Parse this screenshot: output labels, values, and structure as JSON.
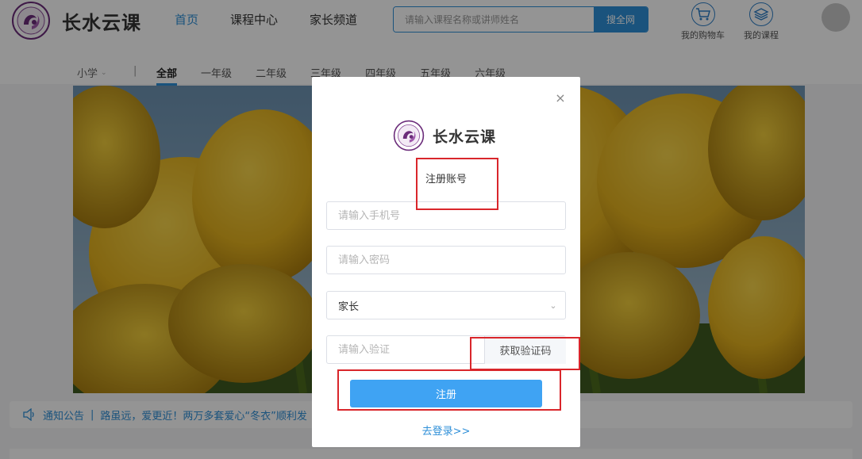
{
  "brand": {
    "name": "长水云课"
  },
  "nav": {
    "items": [
      "首页",
      "课程中心",
      "家长频道"
    ],
    "active_index": 0
  },
  "search": {
    "placeholder": "请输入课程名称或讲师姓名",
    "button": "搜全网"
  },
  "header_links": [
    {
      "label": "我的购物车",
      "icon": "shopping-cart-icon"
    },
    {
      "label": "我的课程",
      "icon": "layers-icon"
    }
  ],
  "grade_bar": {
    "level": "小学",
    "separator": "|",
    "grades": [
      "全部",
      "一年级",
      "二年级",
      "三年级",
      "四年级",
      "五年级",
      "六年级"
    ],
    "active_index": 0
  },
  "notice": {
    "label": "通知公告",
    "separator": "|",
    "text": "路虽远，爱更近！两万多套爱心“冬衣”顺利发"
  },
  "modal": {
    "close_symbol": "×",
    "brand": "长水云课",
    "title": "注册账号",
    "phone_placeholder": "请输入手机号",
    "password_placeholder": "请输入密码",
    "role_value": "家长",
    "code_placeholder": "请输入验证",
    "get_code_button": "获取验证码",
    "submit_button": "注册",
    "login_link": "去登录>>"
  },
  "colors": {
    "accent": "#2e8fd8",
    "submit": "#3fa3f3",
    "annotation": "#d9262b"
  }
}
